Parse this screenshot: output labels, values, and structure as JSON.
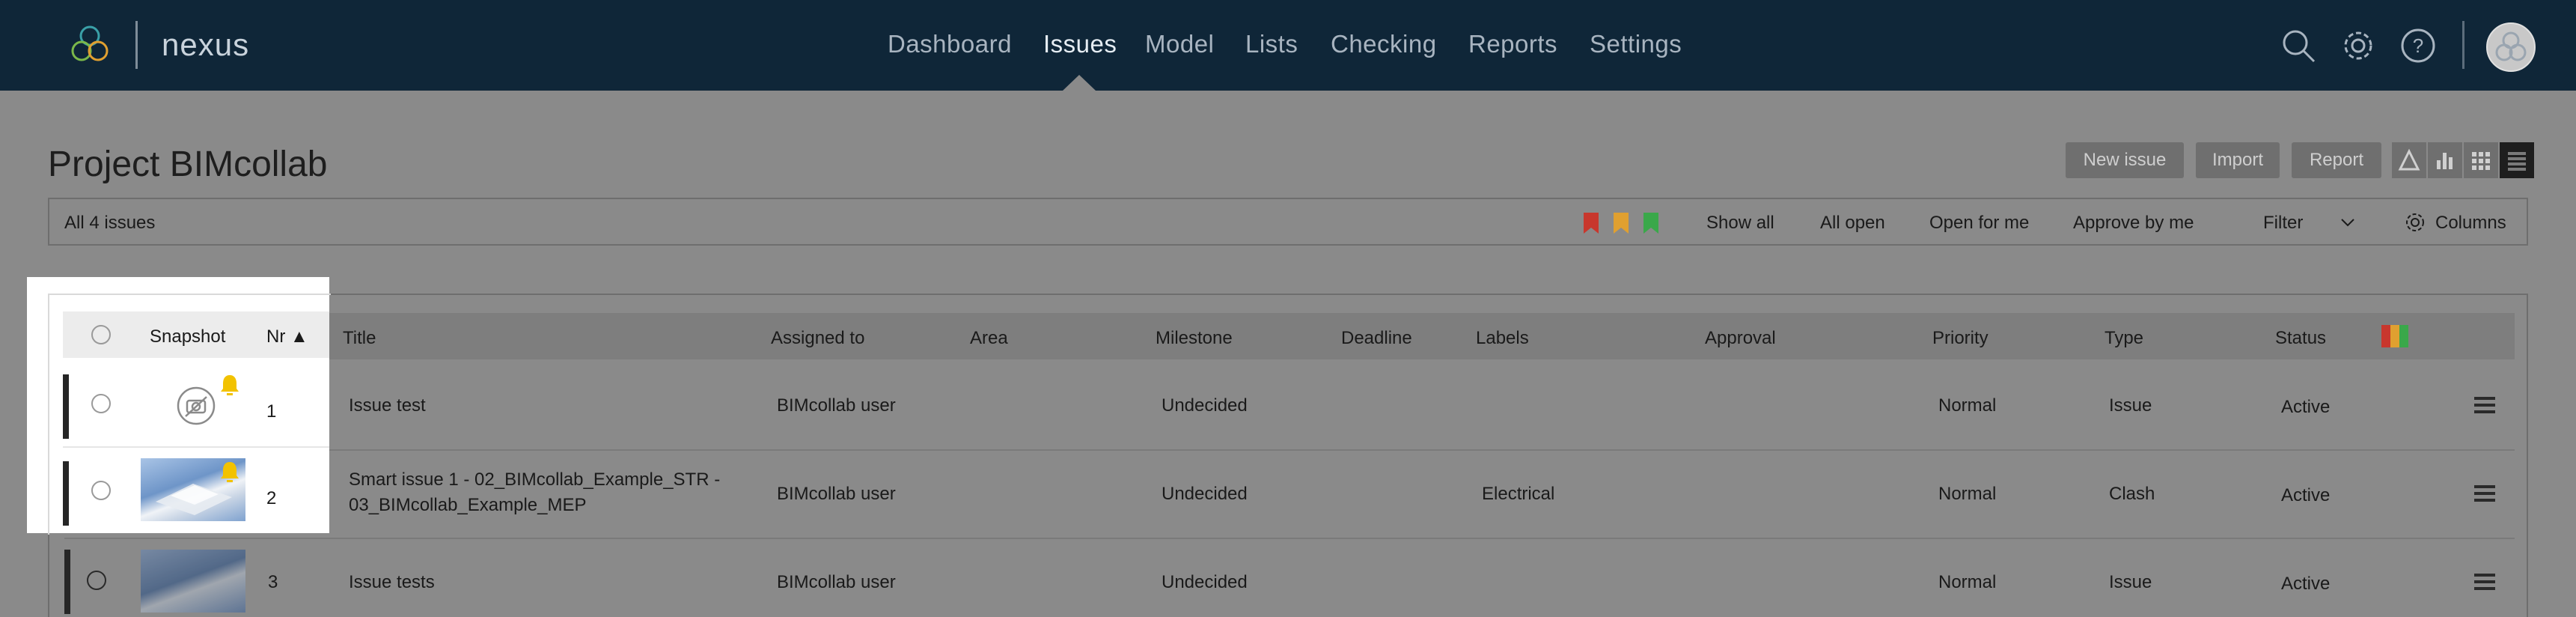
{
  "app": {
    "name": "nexus"
  },
  "nav": {
    "items": [
      {
        "label": "Dashboard",
        "active": false
      },
      {
        "label": "Issues",
        "active": true
      },
      {
        "label": "Model",
        "active": false
      },
      {
        "label": "Lists",
        "active": false
      },
      {
        "label": "Checking",
        "active": false
      },
      {
        "label": "Reports",
        "active": false
      },
      {
        "label": "Settings",
        "active": false
      }
    ],
    "icons": [
      "search-icon",
      "gear-icon",
      "help-icon",
      "avatar"
    ]
  },
  "page": {
    "title": "Project BIMcollab",
    "buttons": {
      "new_issue": "New issue",
      "import": "Import",
      "report": "Report"
    },
    "view_modes": [
      "triangle-view-icon",
      "chart-view-icon",
      "grid-view-icon",
      "list-view-icon"
    ],
    "active_view": "list-view-icon"
  },
  "filter": {
    "count_label": "All 4 issues",
    "flags": [
      "#c8372d",
      "#e0a030",
      "#3aa84a"
    ],
    "links": {
      "show_all": "Show all",
      "all_open": "All open",
      "open_for_me": "Open for me",
      "approve_by_me": "Approve by me",
      "filter": "Filter",
      "columns": "Columns"
    }
  },
  "table": {
    "headers": {
      "snapshot": "Snapshot",
      "nr": "Nr ▲",
      "title": "Title",
      "assigned_to": "Assigned to",
      "area": "Area",
      "milestone": "Milestone",
      "deadline": "Deadline",
      "labels": "Labels",
      "approval": "Approval",
      "priority": "Priority",
      "type": "Type",
      "status": "Status"
    },
    "rows": [
      {
        "nr": "1",
        "title": "Issue test",
        "assigned_to": "BIMcollab user",
        "milestone": "Undecided",
        "labels": "",
        "priority": "Normal",
        "type": "Issue",
        "status": "Active",
        "snapshot": "no-snapshot-icon",
        "notification": true
      },
      {
        "nr": "2",
        "title": "Smart issue 1 - 02_BIMcollab_Example_STR - 03_BIMcollab_Example_MEP",
        "assigned_to": "BIMcollab user",
        "milestone": "Undecided",
        "labels": "Electrical",
        "priority": "Normal",
        "type": "Clash",
        "status": "Active",
        "snapshot": "model-thumbnail",
        "notification": true
      },
      {
        "nr": "3",
        "title": "Issue tests",
        "assigned_to": "BIMcollab user",
        "milestone": "Undecided",
        "labels": "",
        "priority": "Normal",
        "type": "Issue",
        "status": "Active",
        "snapshot": "model-thumbnail",
        "notification": false
      }
    ]
  },
  "colors": {
    "topbar": "#0f2638",
    "overlay": "#8a8a8a",
    "notification_bell": "#f2c200"
  }
}
